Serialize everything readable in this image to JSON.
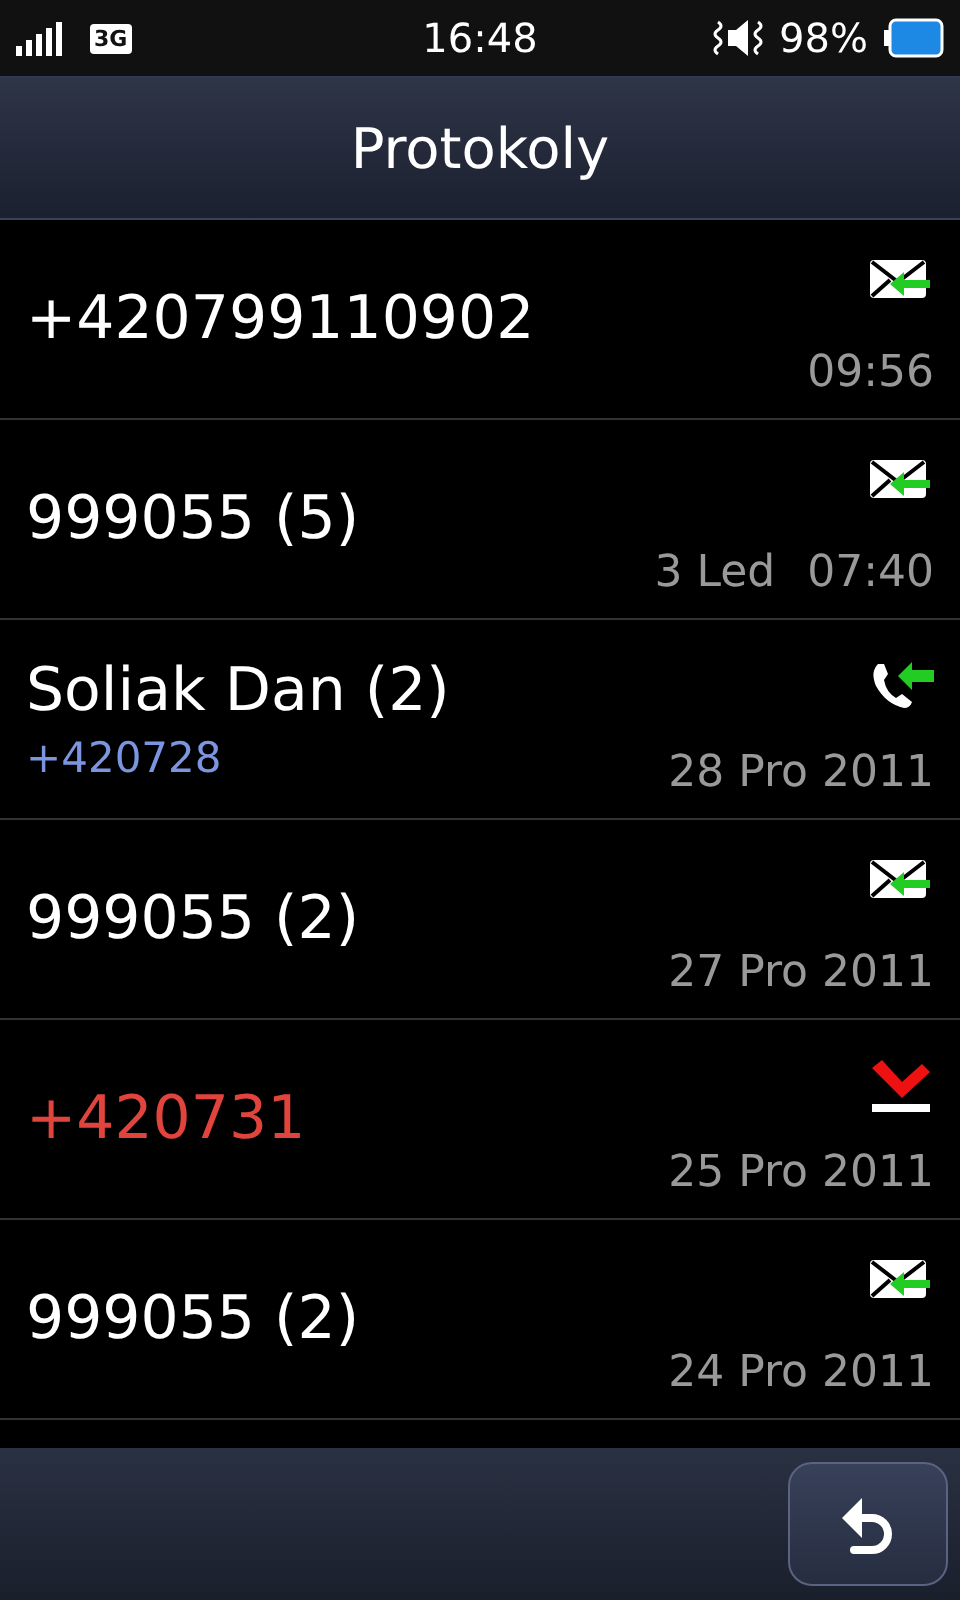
{
  "status_bar": {
    "network": "3G",
    "time": "16:48",
    "battery": "98%"
  },
  "header": {
    "title": "Protokoly"
  },
  "entries": [
    {
      "kind": "message_in",
      "name": "+420799110902",
      "time": "09:56"
    },
    {
      "kind": "message_in",
      "name": "999055 (5)",
      "date": "3 Led",
      "time": "07:40"
    },
    {
      "kind": "call_in",
      "name": "Soliak Dan (2)",
      "subtitle": "+420728",
      "date": "28 Pro 2011"
    },
    {
      "kind": "message_in",
      "name": "999055 (2)",
      "date": "27 Pro 2011"
    },
    {
      "kind": "call_missed",
      "name": "+420731",
      "date": "25 Pro 2011"
    },
    {
      "kind": "message_in",
      "name": "999055 (2)",
      "date": "24 Pro 2011"
    }
  ]
}
